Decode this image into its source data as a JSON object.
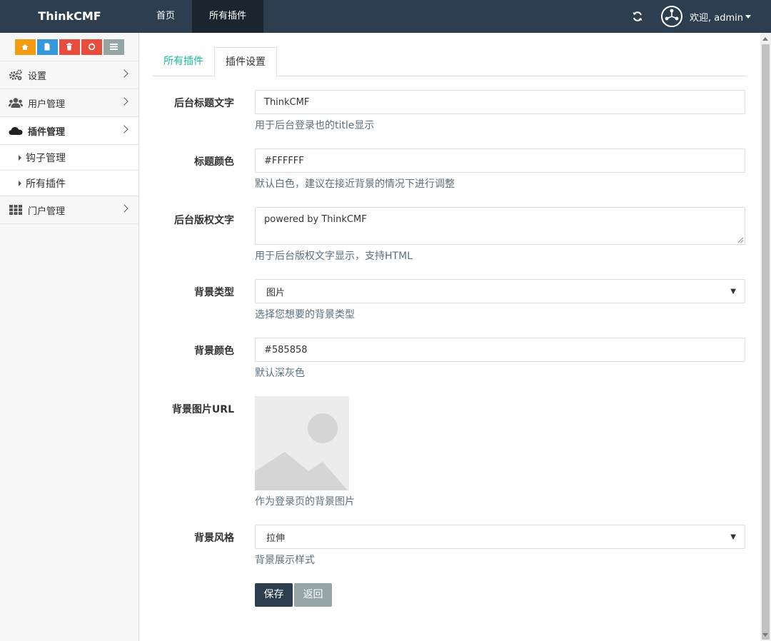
{
  "app": {
    "brand": "ThinkCMF"
  },
  "topnav": {
    "items": [
      {
        "label": "首页"
      },
      {
        "label": "所有插件"
      }
    ]
  },
  "user": {
    "welcome": "欢迎, admin"
  },
  "sidebar": {
    "shortcuts": [
      {
        "icon": "home-icon",
        "color": "#f39c12"
      },
      {
        "icon": "file-icon",
        "color": "#3498db"
      },
      {
        "icon": "trash-icon",
        "color": "#e74c3c"
      },
      {
        "icon": "recycle-icon",
        "color": "#e74c3c"
      },
      {
        "icon": "list-icon",
        "color": "#95a5a6"
      }
    ],
    "items": [
      {
        "label": "设置",
        "icon": "cogs-icon"
      },
      {
        "label": "用户管理",
        "icon": "users-icon"
      },
      {
        "label": "插件管理",
        "icon": "cloud-icon"
      },
      {
        "label": "门户管理",
        "icon": "grid-icon"
      }
    ],
    "subitems": [
      {
        "label": "钩子管理"
      },
      {
        "label": "所有插件"
      }
    ]
  },
  "tabs": [
    {
      "label": "所有插件"
    },
    {
      "label": "插件设置"
    }
  ],
  "form": {
    "admin_title": {
      "label": "后台标题文字",
      "value": "ThinkCMF",
      "help": "用于后台登录也的title显示"
    },
    "title_color": {
      "label": "标题颜色",
      "value": "#FFFFFF",
      "help": "默认白色，建议在接近背景的情况下进行调整"
    },
    "copyright": {
      "label": "后台版权文字",
      "value": "powered by ThinkCMF",
      "help": "用于后台版权文字显示，支持HTML"
    },
    "bg_type": {
      "label": "背景类型",
      "value": "图片",
      "help": "选择您想要的背景类型"
    },
    "bg_color": {
      "label": "背景颜色",
      "value": "#585858",
      "help": "默认深灰色"
    },
    "bg_image": {
      "label": "背景图片URL",
      "help": "作为登录页的背景图片"
    },
    "bg_style": {
      "label": "背景风格",
      "value": "拉伸",
      "help": "背景展示样式"
    }
  },
  "buttons": {
    "save": "保存",
    "back": "返回"
  },
  "colors": {
    "navbar": "#2c3e50",
    "link": "#18bc9c",
    "help": "#5a6f82",
    "back_button": "#95a5a6"
  }
}
